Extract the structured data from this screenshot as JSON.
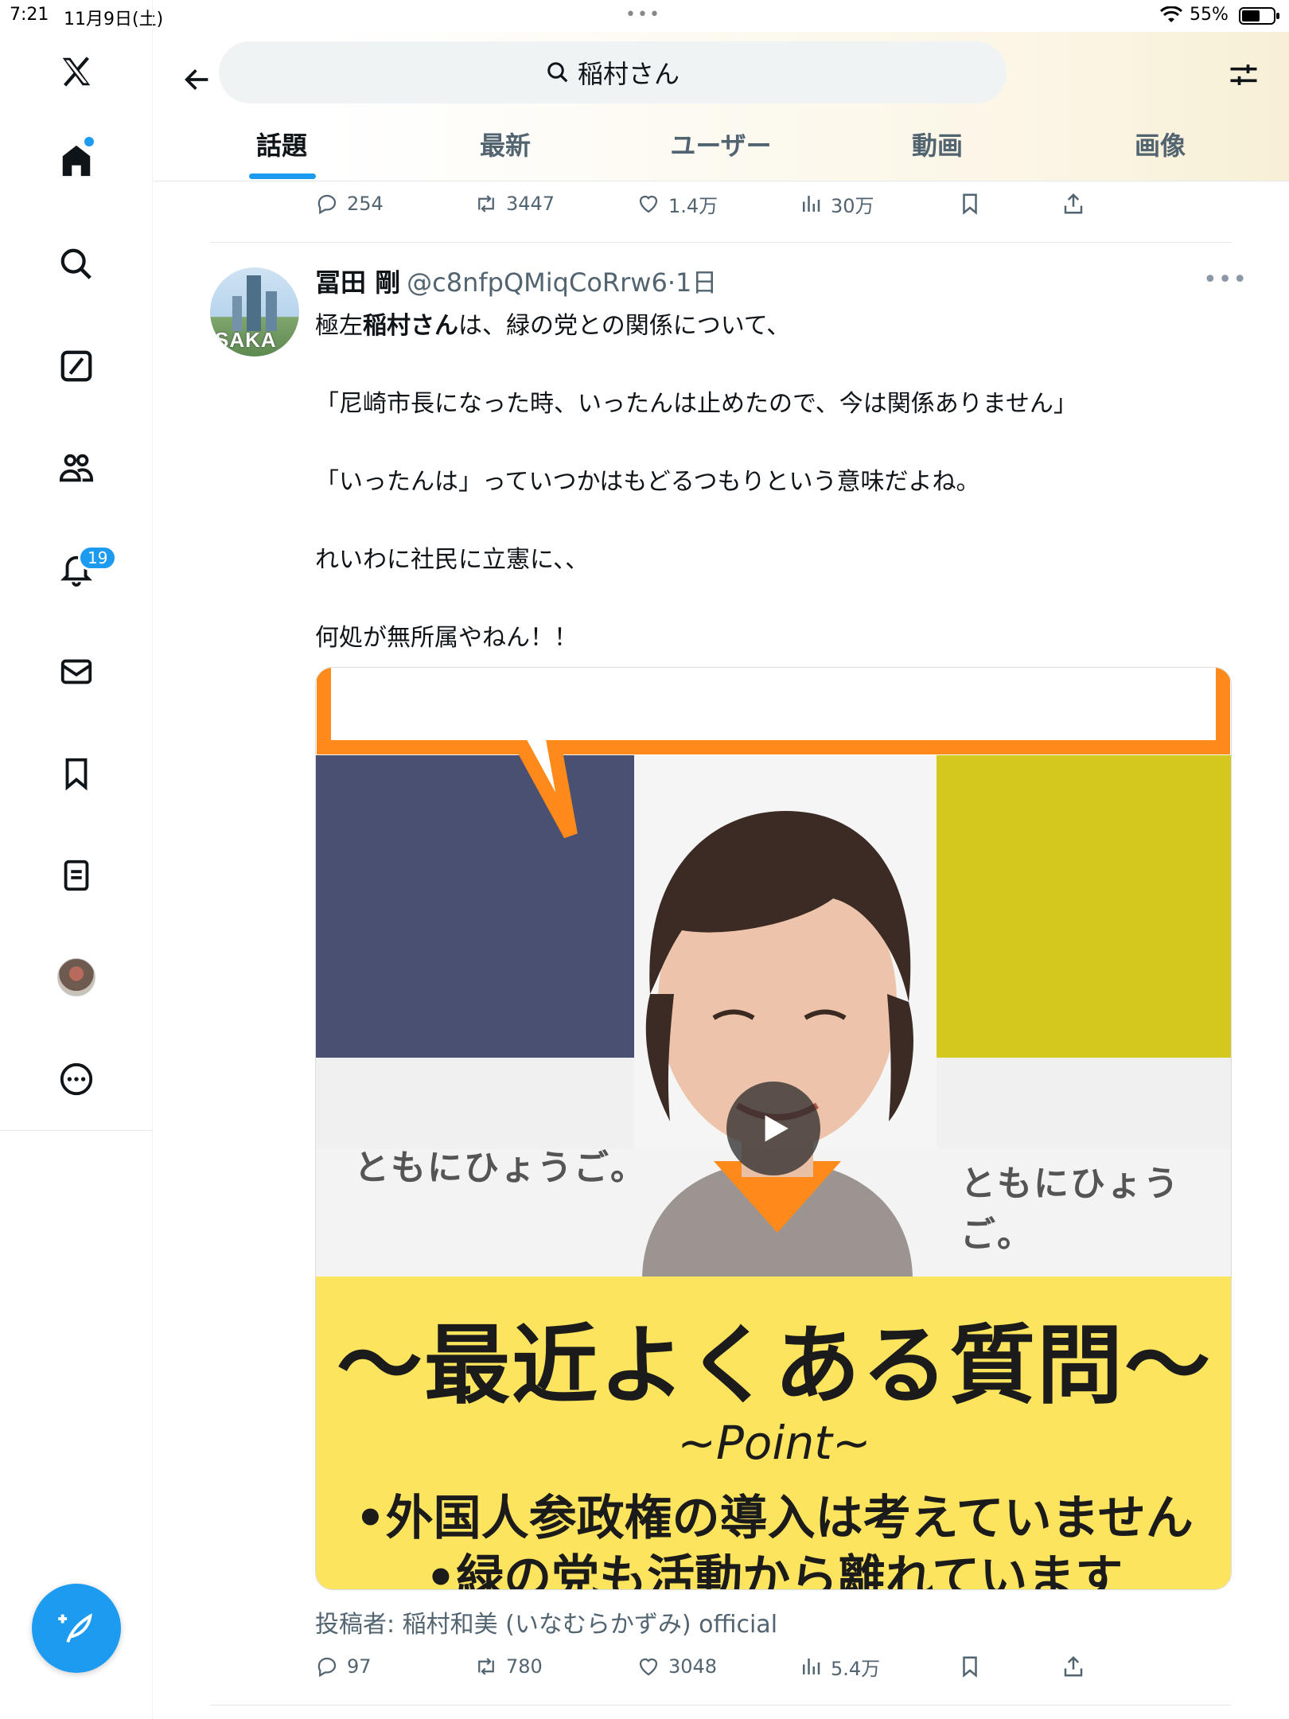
{
  "status_bar": {
    "time": "7:21",
    "date": "11月9日(土)",
    "dots": "•••",
    "battery": "55%"
  },
  "nav": {
    "notifications_badge": "19",
    "accent_color": "#1d9bf0"
  },
  "header": {
    "search_query": "稲村さん",
    "tabs": [
      {
        "label": "話題",
        "active": true
      },
      {
        "label": "最新",
        "active": false
      },
      {
        "label": "ユーザー",
        "active": false
      },
      {
        "label": "動画",
        "active": false
      },
      {
        "label": "画像",
        "active": false
      }
    ]
  },
  "prev_tweet_actions": {
    "replies": "254",
    "retweets": "3447",
    "likes": "1.4万",
    "views": "30万"
  },
  "tweet": {
    "name": "冨田 剛",
    "handle": "@c8nfpQMiqCoRrw6",
    "age": "·1日",
    "more": "•••",
    "avatar_text": "SAKA",
    "lines": [
      {
        "prefix": "極左",
        "bold": "稲村さん",
        "suffix": "は、緑の党との関係について、"
      },
      "「尼崎市長になった時、いったんは止めたので、今は関係ありません」",
      "「いったんは」っていつかはもどるつもりという意味だよね。",
      "れいわに社民に立憲に、、",
      "何処が無所属やねん！！"
    ],
    "media": {
      "caption_left": "ともにひょうご。",
      "caption_right": "ともにひょうご。",
      "headline": "〜最近よくある質問〜",
      "point": "~Point~",
      "bullet1": "•外国人参政権の導入は考えていません",
      "bullet2": "•緑の党も活動から離れています"
    },
    "poster": "投稿者: 稲村和美 (いなむらかずみ) official",
    "actions": {
      "replies": "97",
      "retweets": "780",
      "likes": "3048",
      "views": "5.4万"
    }
  }
}
